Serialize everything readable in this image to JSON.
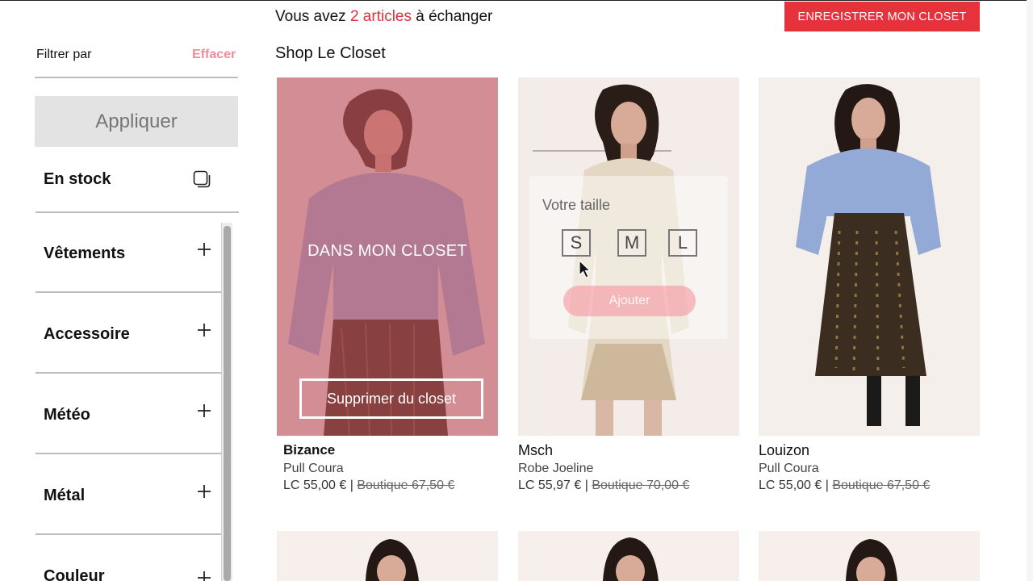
{
  "header": {
    "exchange_prefix": "Vous avez ",
    "exchange_count": "2 articles",
    "exchange_suffix": " à échanger",
    "save_button": "ENREGISTRER MON CLOSET",
    "shop_title": "Shop Le Closet"
  },
  "sidebar": {
    "filter_label": "Filtrer par",
    "clear_label": "Effacer",
    "apply_button": "Appliquer",
    "in_stock_label": "En stock",
    "facets": [
      "Vêtements",
      "Accessoire",
      "Météo",
      "Métal",
      "Couleur"
    ]
  },
  "products": [
    {
      "brand": "Bizance",
      "name": "Pull Coura",
      "price": "LC 55,00 €",
      "separator": " | ",
      "old_price": "Boutique 67,50 €",
      "overlay_text": "DANS MON CLOSET",
      "remove_button": "Supprimer du closet"
    },
    {
      "brand": "Msch",
      "name": "Robe Joeline",
      "price": "LC 55,97 €",
      "separator": " | ",
      "old_price": "Boutique 70,00 €",
      "size_title": "Votre taille",
      "sizes": [
        "S",
        "M",
        "L"
      ],
      "add_button": "Ajouter"
    },
    {
      "brand": "Louizon",
      "name": "Pull Coura",
      "price": "LC 55,00 €",
      "separator": " | ",
      "old_price": "Boutique 67,50 €"
    }
  ],
  "colors": {
    "accent": "#e5323d",
    "clear_link": "#f08c9b",
    "closet_overlay": "#be4b5a"
  }
}
